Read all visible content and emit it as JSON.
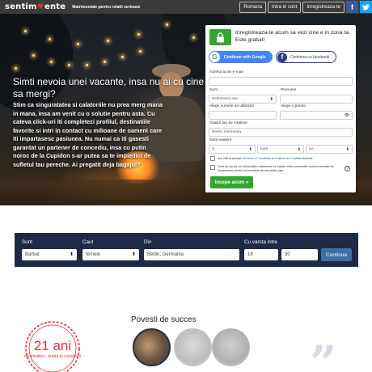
{
  "header": {
    "logo_left": "sentim",
    "logo_right": "ente",
    "tagline": "Matrimoniale pentru relatii serioase",
    "nav": [
      "Romana",
      "Intra in cont",
      "Inregistreaza-te"
    ],
    "facebook_glyph": "f",
    "twitter_glyph": "t"
  },
  "hero": {
    "title": "Simti nevoia unei vacante, insa nu ai cu cine sa mergi?",
    "body": "Stim ca singuratatea si calatoriile nu prea merg mana in mana, insa am venit cu o solutie pentru asta. Cu cateva click-uri iti completezi profilul, destinatiile favorite si intri in contact cu milioane de oameni care iti impartasesc pasiunea. Nu numai ca iti gasesti garantat un partener de concediu, insa cu putin noroc de la Cupidon s-ar putea sa te impiedici de sufletul tau pereche. Ai pregatit deja bagajul?"
  },
  "form": {
    "title": "Inregistreaza-te acum sa vezi cine e in zona ta. Este gratuit!",
    "google_button": "Continue with Google",
    "facebook_button": "Continua cu facebook",
    "email_label": "Adresa ta de e-mail",
    "email_value": "",
    "sunt_label": "Sunt",
    "sunt_value": "Selecteaza sex",
    "prenume_label": "Prenume",
    "prenume_value": "",
    "username_label": "Alege numele de utilizator",
    "username_value": "",
    "password_label": "Alege o parola",
    "password_value": "",
    "city_label": "Orasul tau de intalnire",
    "city_value": "Berlin, Germania",
    "birth_label": "Data nasterii",
    "birth_zi": "zi",
    "birth_luna": "luna",
    "birth_an": "an",
    "terms_prefix": "Am citit si accept ",
    "terms_link1": "Termenii si Conditiile",
    "terms_mid": " si ",
    "terms_link2": "Politica de Confidentialitate",
    "consent_text": "Sunt de acord ca informatiile referitoare la datele mele personale sunt prelucrate de Sentimente pentru a beneficia de serviciile sale.",
    "submit": "Incepe acum »"
  },
  "search": {
    "sunt_label": "Sunt",
    "sunt_value": "Barbat",
    "caut_label": "Caut",
    "caut_value": "femeie",
    "din_label": "Din",
    "din_value": "Berlin, Germania",
    "age_label": "Cu varsta intre",
    "age_min": "18",
    "age_max": "30",
    "button": "Continua"
  },
  "badge": {
    "years": "21 ani",
    "text": "de intalniri, relatii si casatorii"
  },
  "stories": {
    "title": "Povesti de succes"
  },
  "colors": {
    "header_bg": "#3b3b3b",
    "accent_green": "#33a532",
    "navy": "#1f2a44",
    "red": "#e32d37",
    "facebook": "#3b5998",
    "twitter": "#1da1f2"
  },
  "icons": [
    "lock-icon",
    "google-icon",
    "facebook-icon",
    "twitter-icon",
    "eye-icon",
    "question-icon",
    "laurel-icon",
    "quote-icon"
  ]
}
